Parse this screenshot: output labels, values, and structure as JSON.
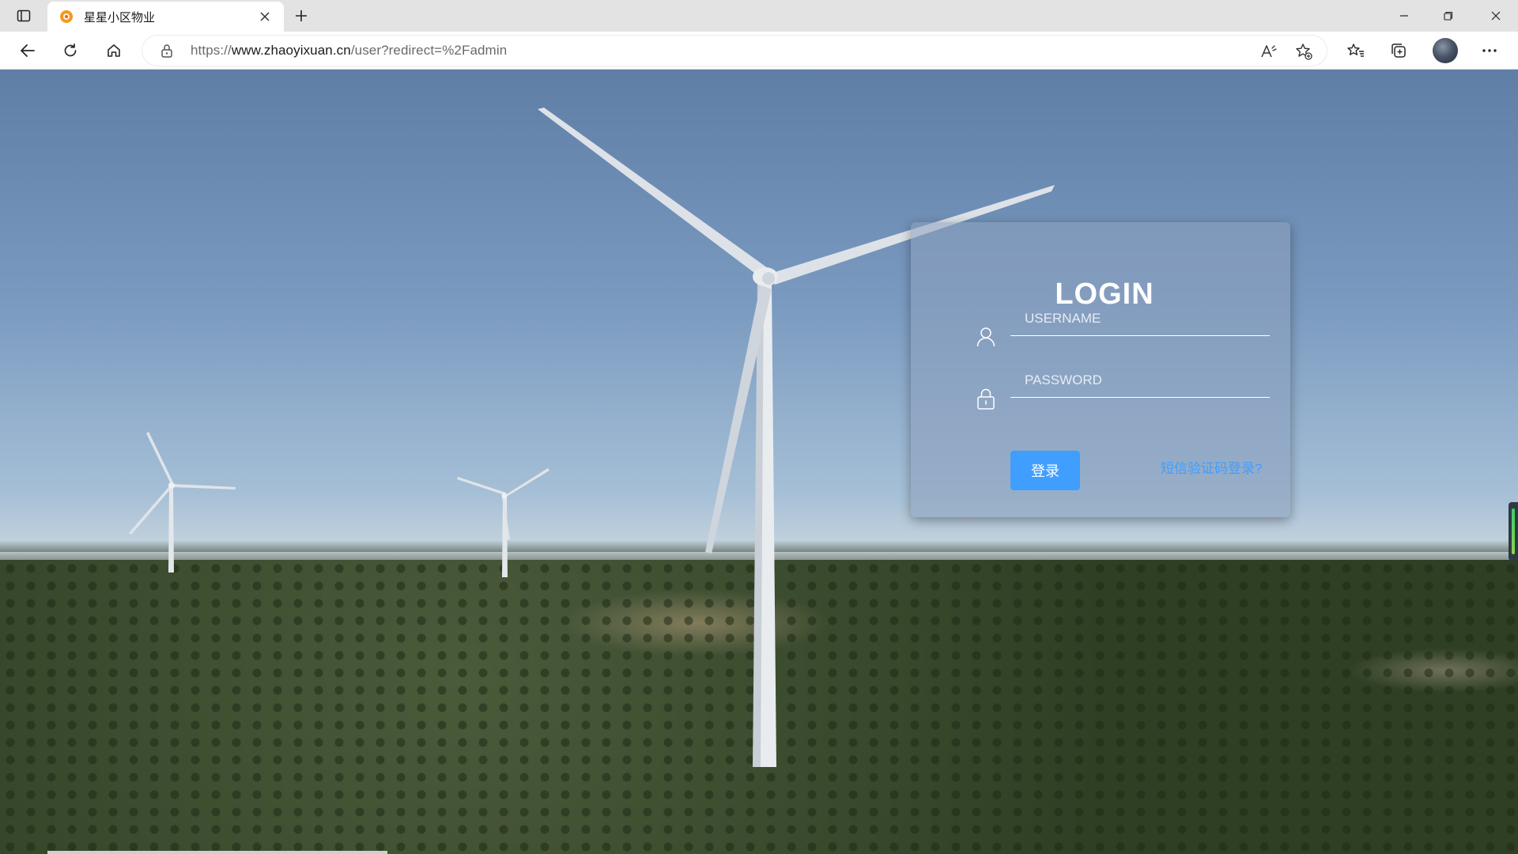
{
  "browser": {
    "tab": {
      "title": "星星小区物业",
      "favicon": "orange-flower-icon"
    },
    "address": {
      "scheme": "https://",
      "domain": "www.zhaoyixuan.cn",
      "path": "/user?redirect=%2Fadmin"
    }
  },
  "login": {
    "title": "LOGIN",
    "username_placeholder": "USERNAME",
    "password_placeholder": "PASSWORD",
    "submit_label": "登录",
    "sms_link": "短信验证码登录?"
  },
  "colors": {
    "accent": "#409eff",
    "card": "rgba(140,160,190,0.55)"
  }
}
